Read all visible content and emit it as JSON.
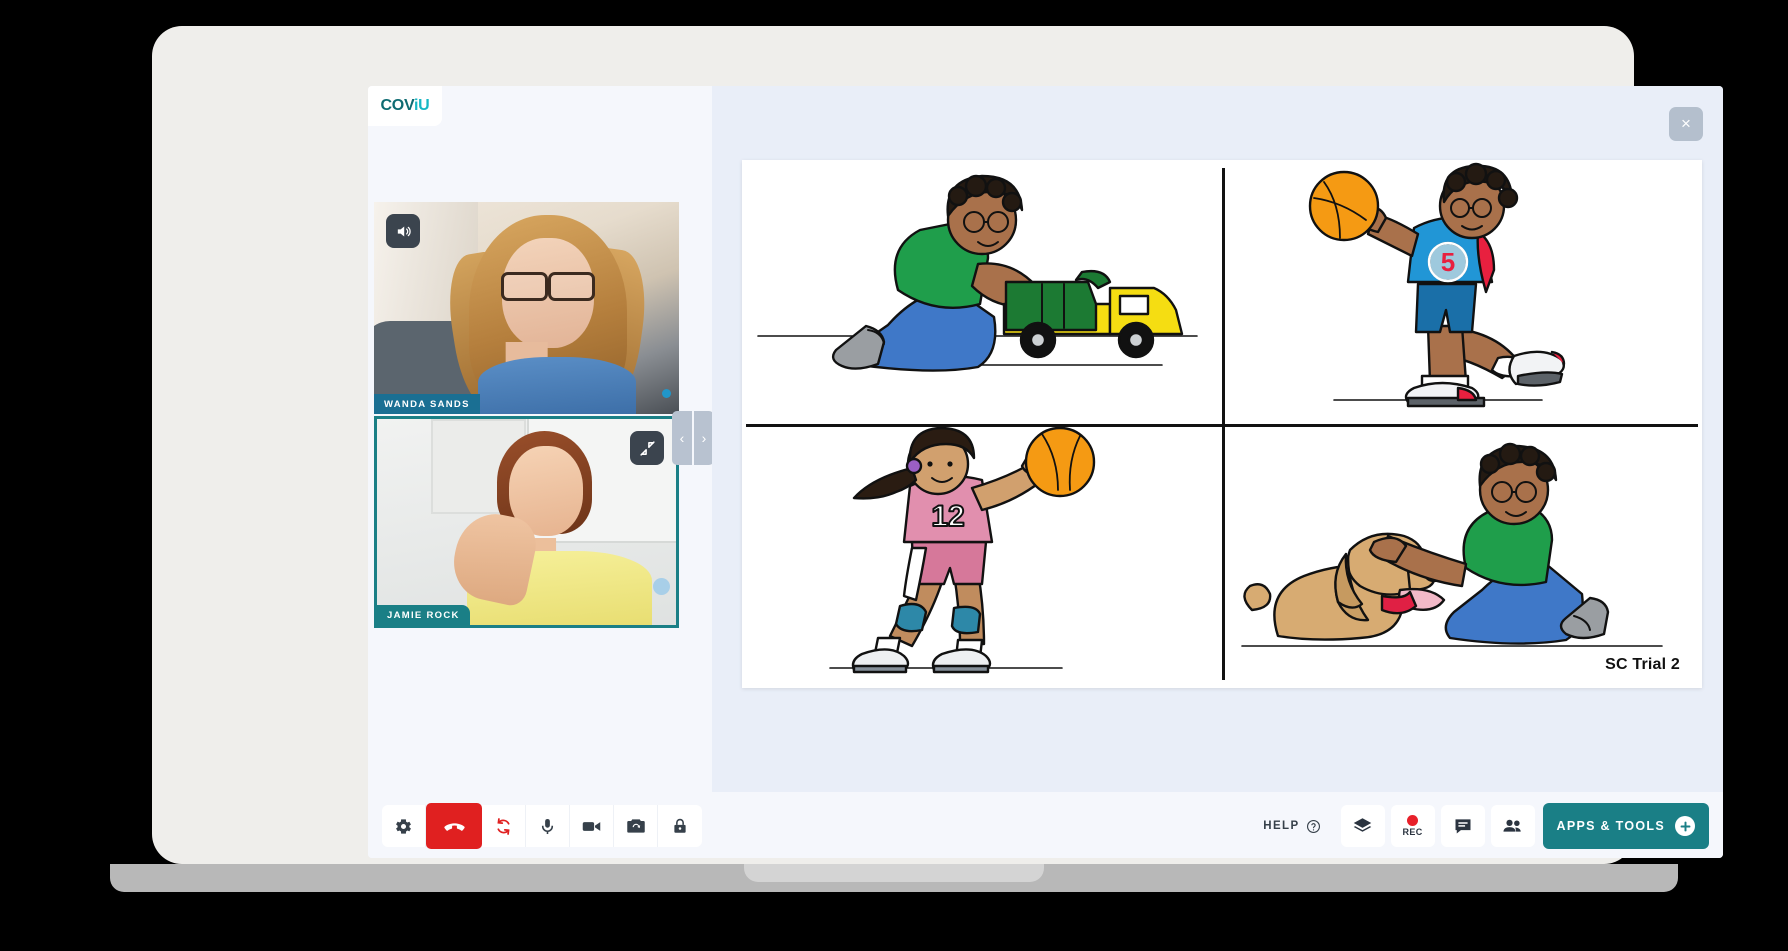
{
  "brand": {
    "logo_prefix": "COV",
    "logo_suffix": "iU"
  },
  "left_panel": {
    "participants": [
      {
        "name": "WANDA SANDS",
        "control_icon": "speaker-icon"
      },
      {
        "name": "JAMIE ROCK",
        "control_icon": "collapse-icon"
      }
    ],
    "carousel": {
      "prev": "‹",
      "next": "›"
    }
  },
  "content": {
    "close_label": "×",
    "trial_label": "SC Trial 2",
    "quadrants": [
      {
        "id": "top-left",
        "description": "Boy in green shirt kneeling pushing a yellow toy dump truck"
      },
      {
        "id": "top-right",
        "description": "Boy in blue jersey number 5 throwing an orange ball",
        "jersey_number": "5"
      },
      {
        "id": "bottom-left",
        "description": "Girl in pink jersey number 12 holding an orange ball",
        "jersey_number": "12"
      },
      {
        "id": "bottom-right",
        "description": "Boy in green shirt kneeling petting a tan dog"
      }
    ]
  },
  "toolbar": {
    "left_buttons": [
      {
        "name": "settings",
        "icon": "gear-icon"
      },
      {
        "name": "hang-up",
        "icon": "phone-hangup-icon"
      },
      {
        "name": "reconnect",
        "icon": "refresh-icon"
      },
      {
        "name": "microphone",
        "icon": "microphone-icon"
      },
      {
        "name": "camera",
        "icon": "video-camera-icon"
      },
      {
        "name": "switch-camera",
        "icon": "camera-switch-icon"
      },
      {
        "name": "lock",
        "icon": "lock-icon"
      }
    ],
    "help_label": "HELP",
    "right_buttons": [
      {
        "name": "layers",
        "icon": "layers-icon"
      },
      {
        "name": "record",
        "icon": "record-dot-icon",
        "label": "REC"
      },
      {
        "name": "chat",
        "icon": "chat-bubble-icon"
      },
      {
        "name": "participants",
        "icon": "people-icon"
      }
    ],
    "apps_tools_label": "APPS & TOOLS"
  },
  "colors": {
    "brand_teal": "#1a7f86",
    "logo_dark": "#0e6b72",
    "logo_light": "#17b7c4",
    "danger_red": "#e02020",
    "record_red": "#e8202a",
    "name_badge_blue": "#1a6f93",
    "screen_bg": "#f5f7fc",
    "content_bg": "#e9eef8"
  }
}
